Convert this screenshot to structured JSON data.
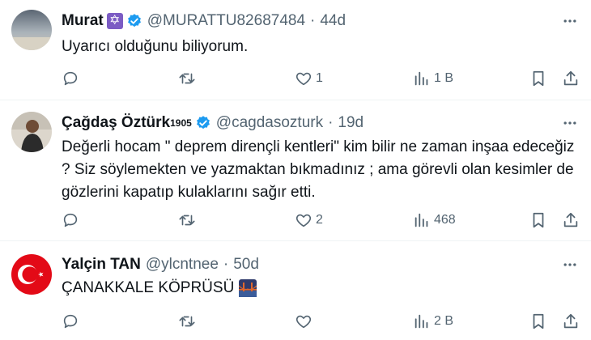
{
  "tweets": [
    {
      "name": "Murat",
      "handle": "@MURATTU82687484",
      "dot": "·",
      "time": "44d",
      "text_lines": [
        "Uyarıcı olduğunu biliyorum."
      ],
      "reply_count": "",
      "retweet_count": "",
      "like_count": "1",
      "views": "1 B"
    },
    {
      "name": "Çağdaş Öztürk",
      "name_sup": "1905",
      "handle": "@cagdasozturk",
      "dot": "·",
      "time": "19d",
      "text_lines": [
        "Değerli hocam \" deprem dirençli kentleri\" kim bilir ne zaman inşaa edeceğiz",
        "?  Siz söylemekten ve yazmaktan bıkmadınız  ; ama  görevli olan kesimler de",
        "gözlerini kapatıp kulaklarını sağır etti."
      ],
      "reply_count": "",
      "retweet_count": "",
      "like_count": "2",
      "views": "468"
    },
    {
      "name": "Yalçin TAN",
      "handle": "@ylcntnee",
      "dot": "·",
      "time": "50d",
      "text_lines": [
        "ÇANAKKALE KÖPRÜSÜ"
      ],
      "reply_count": "",
      "retweet_count": "",
      "like_count": "",
      "views": "2 B"
    }
  ],
  "icons": {
    "more": "more-icon",
    "reply": "reply-icon",
    "retweet": "retweet-icon",
    "like": "heart-icon",
    "views": "views-icon",
    "bookmark": "bookmark-icon",
    "share": "share-icon",
    "verified": "verified-badge-icon",
    "star_of_david": "star-of-david-icon",
    "bridge_emoji": "bridge-emoji-icon"
  },
  "colors": {
    "text": "#0f1419",
    "secondary": "#536471",
    "verified": "#1d9bf0",
    "divider": "#eff3f4"
  }
}
